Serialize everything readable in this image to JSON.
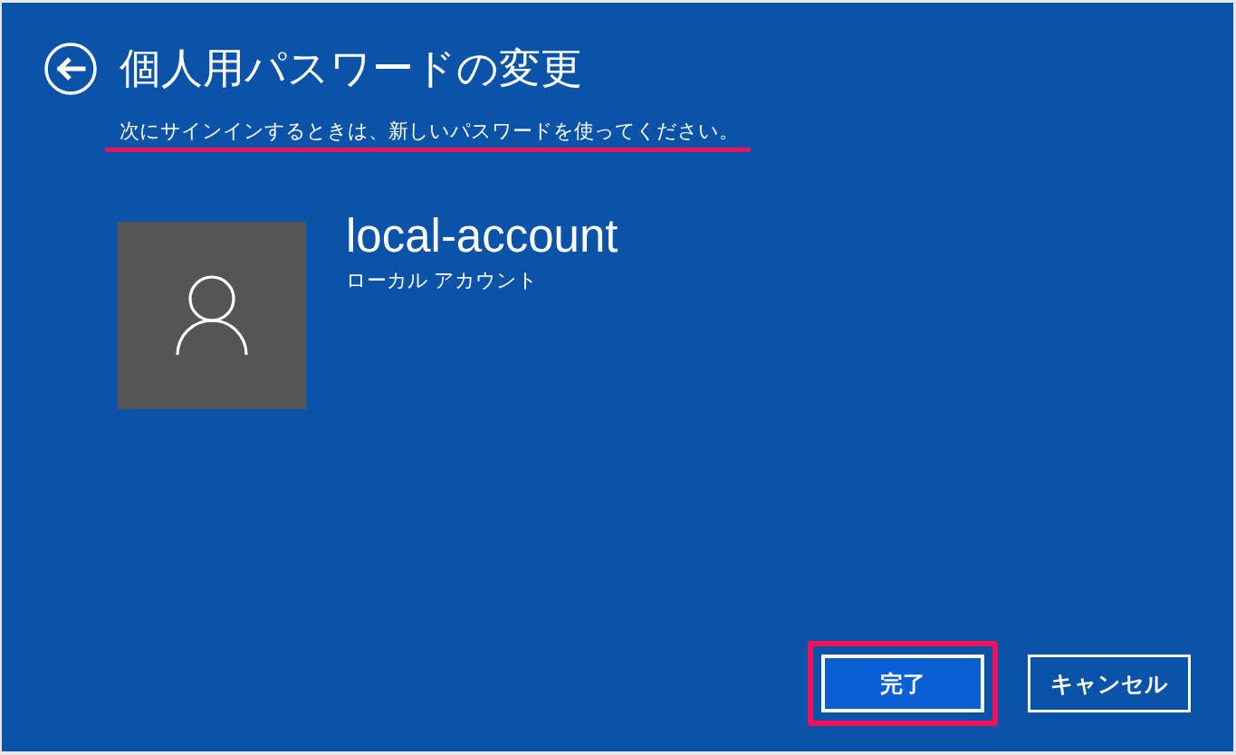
{
  "header": {
    "title": "個人用パスワードの変更",
    "subtitle": {
      "text": "次にサインインするときは、新しいパスワードを使ってください。",
      "highlighted": true
    }
  },
  "account": {
    "name": "local-account",
    "type": "ローカル アカウント"
  },
  "buttons": [
    {
      "label": "完了",
      "kind": "primary",
      "highlighted": true
    },
    {
      "label": "キャンセル",
      "kind": "secondary",
      "highlighted": false
    }
  ]
}
